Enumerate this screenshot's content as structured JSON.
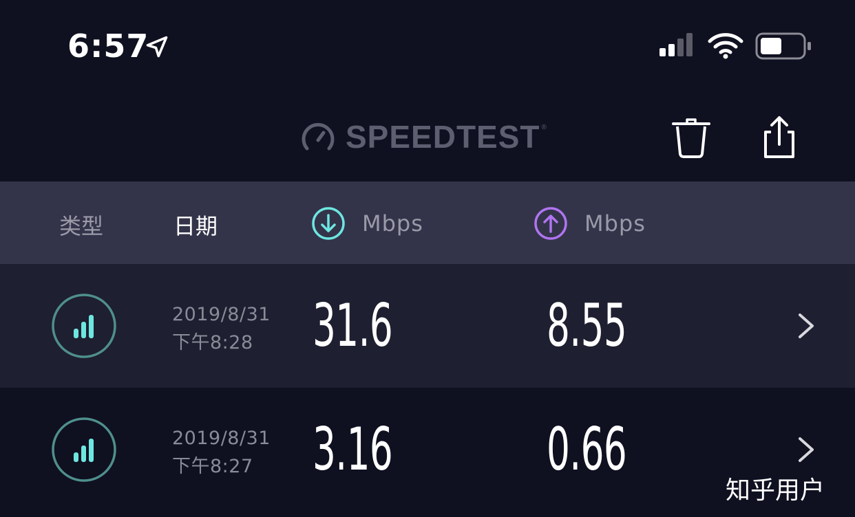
{
  "status_bar": {
    "time": "6:57",
    "icons": [
      "location-arrow-icon",
      "cellular-signal-icon",
      "wifi-icon",
      "battery-icon"
    ]
  },
  "nav": {
    "logo_text": "SPEEDTEST",
    "logo_mark": "®",
    "actions": [
      "trash-icon",
      "share-icon"
    ]
  },
  "header": {
    "type_label": "类型",
    "date_label": "日期",
    "download_unit": "Mbps",
    "upload_unit": "Mbps"
  },
  "results": [
    {
      "date": "2019/8/31",
      "time": "下午8:28",
      "download": "31.6",
      "upload": "8.55"
    },
    {
      "date": "2019/8/31",
      "time": "下午8:27",
      "download": "3.16",
      "upload": "0.66"
    }
  ],
  "watermark": "知乎用户",
  "colors": {
    "background": "#0f1020",
    "header_bg": "#33344a",
    "row_highlight": "#1e1f30",
    "download_accent": "#6ee6e0",
    "upload_accent": "#b074f0",
    "type_icon_ring": "#4f8f8c"
  }
}
